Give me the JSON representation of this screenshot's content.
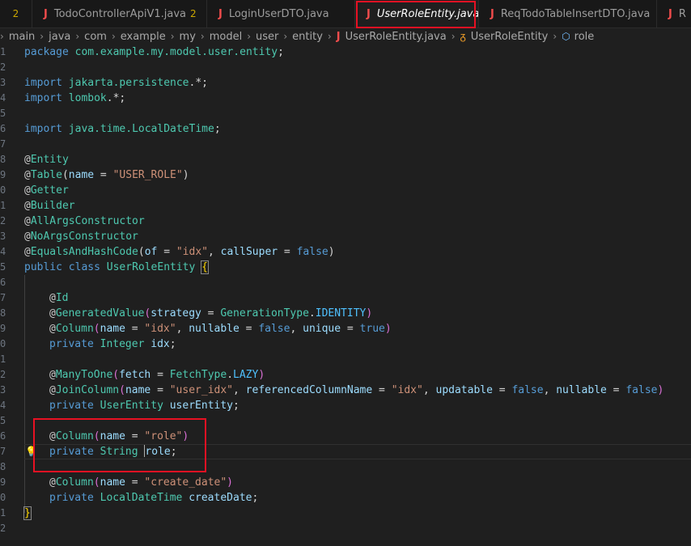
{
  "tabs": [
    {
      "label": "",
      "badge": "2"
    },
    {
      "label": "TodoControllerApiV1.java",
      "badge": "2"
    },
    {
      "label": "LoginUserDTO.java"
    },
    {
      "label": "UserRoleEntity.java",
      "close": "✕"
    },
    {
      "label": "ReqTodoTableInsertDTO.java"
    },
    {
      "label": "R"
    }
  ],
  "icons": {
    "file_type": "J",
    "symbol": "⬡"
  },
  "breadcrumb": [
    "main",
    "java",
    "com",
    "example",
    "my",
    "model",
    "user",
    "entity",
    "UserRoleEntity.java",
    "UserRoleEntity",
    "role"
  ],
  "line_numbers": [
    "1",
    "2",
    "3",
    "4",
    "5",
    "6",
    "7",
    "8",
    "9",
    "0",
    "1",
    "2",
    "3",
    "4",
    "5",
    "6",
    "7",
    "8",
    "9",
    "0",
    "1",
    "2",
    "3",
    "4",
    "5",
    "6",
    "7",
    "8",
    "9",
    "0",
    "1",
    "2"
  ],
  "code": {
    "l1_kw": "package",
    "l1_pkg": "com.example.my.model.user.entity",
    "imp": "import",
    "l3_pkg": "jakarta.persistence",
    "l3_tail": ".*;",
    "l4_pkg": "lombok",
    "l4_tail": ".*;",
    "l6_pkg": "java.time.",
    "l6_cls": "LocalDateTime",
    "at": "@",
    "entity": "Entity",
    "table": "Table",
    "name": "name",
    "user_role": "\"USER_ROLE\"",
    "getter": "Getter",
    "builder": "Builder",
    "allargs": "AllArgsConstructor",
    "noargs": "NoArgsConstructor",
    "eqhash": "EqualsAndHashCode",
    "of": "of",
    "idx_str": "\"idx\"",
    "callsuper": "callSuper",
    "false": "false",
    "true": "true",
    "public": "public",
    "class": "class",
    "class_name": "UserRoleEntity",
    "id": "Id",
    "genval": "GeneratedValue",
    "strategy": "strategy",
    "gentype": "GenerationType",
    "identity": "IDENTITY",
    "column": "Column",
    "nullable": "nullable",
    "unique": "unique",
    "private": "private",
    "integer": "Integer",
    "idx_var": "idx",
    "manytoone": "ManyToOne",
    "fetch": "fetch",
    "fetchtype": "FetchType",
    "lazy": "LAZY",
    "joincol": "JoinColumn",
    "user_idx": "\"user_idx\"",
    "refcol": "referencedColumnName",
    "updatable": "updatable",
    "userentity": "UserEntity",
    "userentity_var": "userEntity",
    "role_str": "\"role\"",
    "string": "String",
    "role_r": "r",
    "role_rest": "ole",
    "create_date": "\"create_date\"",
    "ldt": "LocalDateTime",
    "createdate": "createDate"
  },
  "colors": {
    "highlight": "#e81123",
    "file_icon": "#f14c4c"
  }
}
